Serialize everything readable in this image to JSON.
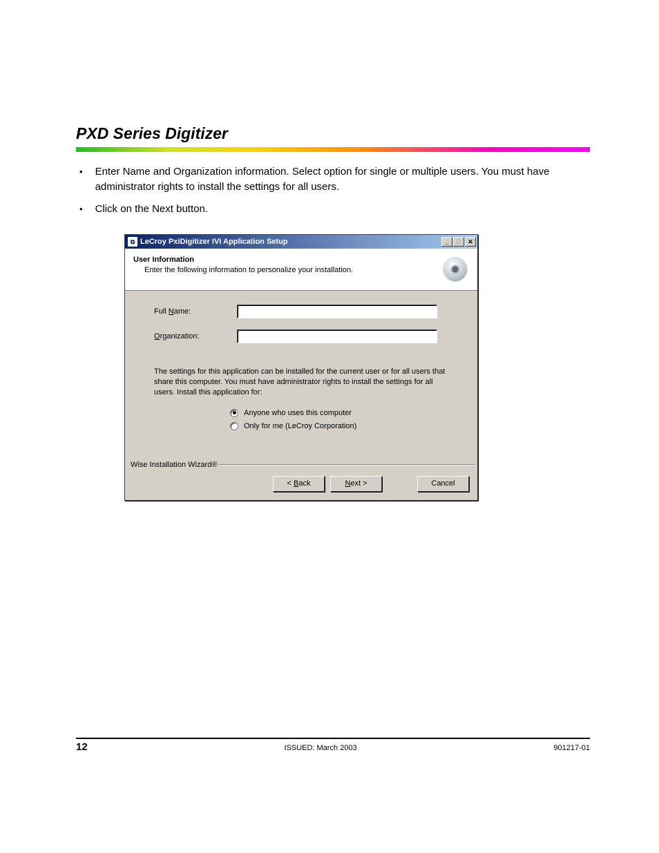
{
  "heading": "PXD Series Digitizer",
  "bullets": [
    "Enter Name and Organization information. Select option for single or multiple users. You must have administrator rights to install the settings for all users.",
    "Click on the Next button."
  ],
  "window": {
    "title": "LeCroy PxiDigitizer IVI Application Setup",
    "header_title": "User Information",
    "header_sub": "Enter the following information to personalize your installation.",
    "full_name_label_pre": "Full ",
    "full_name_label_u": "N",
    "full_name_label_post": "ame:",
    "full_name_value": "",
    "org_label_u": "O",
    "org_label_post": "rganization:",
    "org_value": "",
    "info_text": "The settings for this application can be installed for the current user or for all users that share this computer. You must have administrator rights to install the settings for all users. Install this application for:",
    "radio1_u": "A",
    "radio1_post": "nyone who uses this computer",
    "radio2_pre": "Only for ",
    "radio2_u": "m",
    "radio2_post": "e (LeCroy Corporation)",
    "wise": "Wise Installation Wizard®",
    "back_pre": "< ",
    "back_u": "B",
    "back_post": "ack",
    "next_u": "N",
    "next_post": "ext >",
    "cancel": "Cancel"
  },
  "footer": {
    "page": "12",
    "center": "ISSUED: March 2003",
    "right": "901217-01"
  }
}
